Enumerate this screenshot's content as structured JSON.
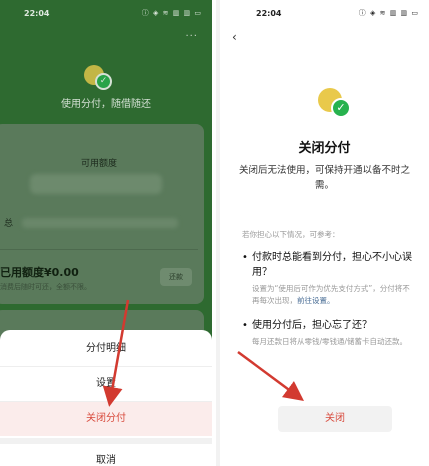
{
  "status_bar": {
    "time": "22:04",
    "icons": "ⓘ ◈ ≋ ▥ ▥ ▭"
  },
  "left": {
    "more_icon": "···",
    "slogan": "使用分付，随借随还",
    "available_label": "可用额度",
    "total_prefix": "总",
    "used_label": "已用额度¥0.00",
    "used_sub": "消费后随时可还，全额不限。",
    "repay_label": "还款",
    "sheet": {
      "details": "分付明细",
      "settings": "设置",
      "close": "关闭分付",
      "cancel": "取消"
    }
  },
  "right": {
    "back_icon": "‹",
    "title": "关闭分付",
    "description": "关闭后无法使用，可保持开通以备不时之需。",
    "section_hint": "若你担心以下情况，可参考：",
    "q1_title": "付款时总能看到分付，担心不小心误用？",
    "q1_sub": "设置为“使用后可作为优先支付方式”，分付将不再每次出现，",
    "q1_link": "前往设置。",
    "q2_title": "使用分付后，担心忘了还？",
    "q2_sub": "每月还款日将从零钱/零钱通/储蓄卡自动还款。",
    "close_button": "关闭"
  },
  "colors": {
    "accent_red": "#d84a3c",
    "brand_green": "#27b24e",
    "coin_yellow": "#e9c94b"
  }
}
